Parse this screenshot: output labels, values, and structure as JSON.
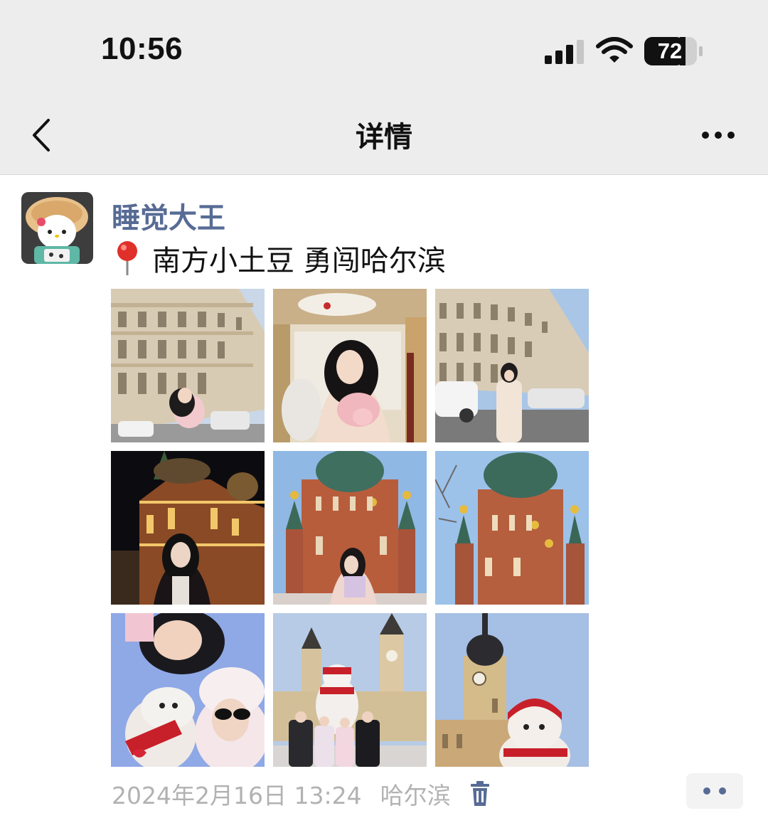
{
  "status_bar": {
    "time": "10:56",
    "battery": "72",
    "icons": [
      "signal-icon",
      "wifi-icon",
      "battery-icon"
    ]
  },
  "header": {
    "title": "详情",
    "back_icon": "chevron-left-icon",
    "more_icon": "more-dots-icon"
  },
  "post": {
    "author": "睡觉大王",
    "avatar_icon": "hello-kitty-avatar",
    "location_icon": "red-pin-icon",
    "text": "南方小土豆 勇闯哈尔滨",
    "photos": [
      {
        "subject": "european-building-street-portrait"
      },
      {
        "subject": "ornate-interior-portrait"
      },
      {
        "subject": "european-building-street-portrait"
      },
      {
        "subject": "cathedral-night-portrait"
      },
      {
        "subject": "cathedral-day-portrait"
      },
      {
        "subject": "cathedral-day"
      },
      {
        "subject": "snowman-selfie"
      },
      {
        "subject": "snowman-tower-group"
      },
      {
        "subject": "snowman-tower"
      }
    ],
    "date": "2024年2月16日 13:24",
    "location": "哈尔滨",
    "delete_icon": "trash-icon",
    "action_icon": "two-dots-icon"
  },
  "colors": {
    "header_bg": "#ededed",
    "author_link": "#576b95",
    "meta_text": "#b2b2b2",
    "delete_icon": "#576b95"
  }
}
